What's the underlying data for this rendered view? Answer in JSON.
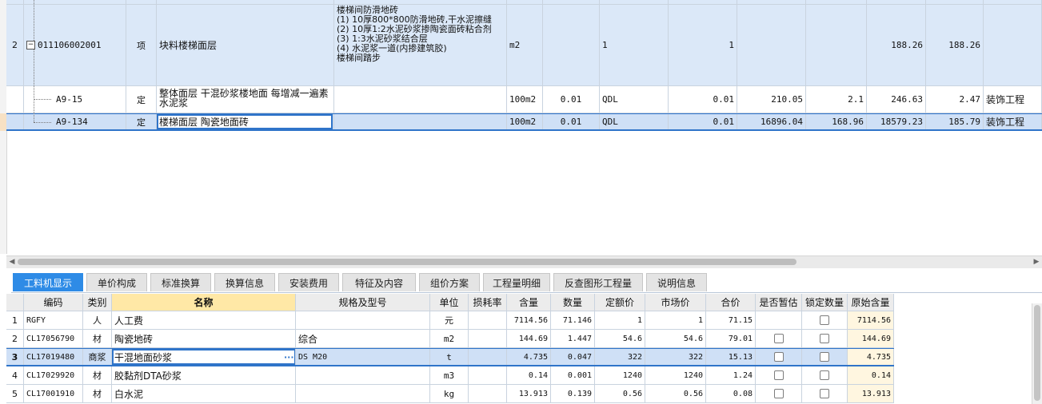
{
  "top_grid": {
    "rows": [
      {
        "index": "2",
        "code": "011106002001",
        "type": "项",
        "name": "块料楼梯面层",
        "feature_lines": [
          "楼梯间防滑地砖",
          "(1) 10厚800*800防滑地砖,干水泥擦缝",
          "(2) 10厚1:2水泥砂浆掺陶瓷面砖粘合剂",
          "(3) 1:3水泥砂浆结合层",
          "(4) 水泥浆一道(内掺建筑胶)",
          "楼梯间踏步"
        ],
        "unit": "m2",
        "expr": "1",
        "qty": "1",
        "price": "188.26",
        "total": "188.26"
      },
      {
        "index": "",
        "code": "A9-15",
        "type": "定",
        "name": "整体面层 干混砂浆楼地面 每增减一遍素水泥浆",
        "unit": "100m2",
        "content": "0.01",
        "expr": "QDL",
        "qty": "0.01",
        "unit_price": "210.05",
        "sum": "2.1",
        "price": "246.63",
        "total": "2.47",
        "speciality": "装饰工程"
      },
      {
        "index": "",
        "code": "A9-134",
        "type": "定",
        "name": "楼梯面层 陶瓷地面砖",
        "unit": "100m2",
        "content": "0.01",
        "expr": "QDL",
        "qty": "0.01",
        "unit_price": "16896.04",
        "sum": "168.96",
        "price": "18579.23",
        "total": "185.79",
        "speciality": "装饰工程"
      }
    ]
  },
  "tabs": [
    {
      "label": "工料机显示",
      "active": true
    },
    {
      "label": "单价构成"
    },
    {
      "label": "标准换算"
    },
    {
      "label": "换算信息"
    },
    {
      "label": "安装费用"
    },
    {
      "label": "特征及内容"
    },
    {
      "label": "组价方案"
    },
    {
      "label": "工程量明细"
    },
    {
      "label": "反查图形工程量"
    },
    {
      "label": "说明信息"
    }
  ],
  "bottom_grid": {
    "headers": [
      "编码",
      "类别",
      "名称",
      "规格及型号",
      "单位",
      "损耗率",
      "含量",
      "数量",
      "定额价",
      "市场价",
      "合价",
      "是否暂估",
      "锁定数量",
      "原始含量"
    ],
    "rows": [
      {
        "idx": "1",
        "code": "RGFY",
        "cat": "人",
        "name": "人工费",
        "spec": "",
        "unit": "元",
        "loss": "",
        "content": "7114.56",
        "qty": "71.146",
        "quota": "1",
        "market": "1",
        "sum": "71.15",
        "provisional": false,
        "lock": false,
        "orig": "7114.56"
      },
      {
        "idx": "2",
        "code": "CL17056790",
        "cat": "材",
        "name": "陶瓷地砖",
        "spec": "综合",
        "unit": "m2",
        "loss": "",
        "content": "144.69",
        "qty": "1.447",
        "quota": "54.6",
        "market": "54.6",
        "sum": "79.01",
        "provisional": false,
        "lock": false,
        "orig": "144.69"
      },
      {
        "idx": "3",
        "code": "CL17019480",
        "cat": "商浆",
        "name": "干混地面砂浆",
        "spec": "DS M20",
        "unit": "t",
        "loss": "",
        "content": "4.735",
        "qty": "0.047",
        "quota": "322",
        "market": "322",
        "sum": "15.13",
        "provisional": false,
        "lock": false,
        "orig": "4.735"
      },
      {
        "idx": "4",
        "code": "CL17029920",
        "cat": "材",
        "name": "胶黏剂DTA砂浆",
        "spec": "",
        "unit": "m3",
        "loss": "",
        "content": "0.14",
        "qty": "0.001",
        "quota": "1240",
        "market": "1240",
        "sum": "1.24",
        "provisional": false,
        "lock": false,
        "orig": "0.14"
      },
      {
        "idx": "5",
        "code": "CL17001910",
        "cat": "材",
        "name": "白水泥",
        "spec": "",
        "unit": "kg",
        "loss": "",
        "content": "13.913",
        "qty": "0.139",
        "quota": "0.56",
        "market": "0.56",
        "sum": "0.08",
        "provisional": false,
        "lock": false,
        "orig": "13.913"
      }
    ]
  },
  "colors": {
    "accent": "#2e8be6",
    "selection": "#cfe0f6",
    "bill_row": "#dbe8f8",
    "header_highlight": "#ffe8a6"
  }
}
